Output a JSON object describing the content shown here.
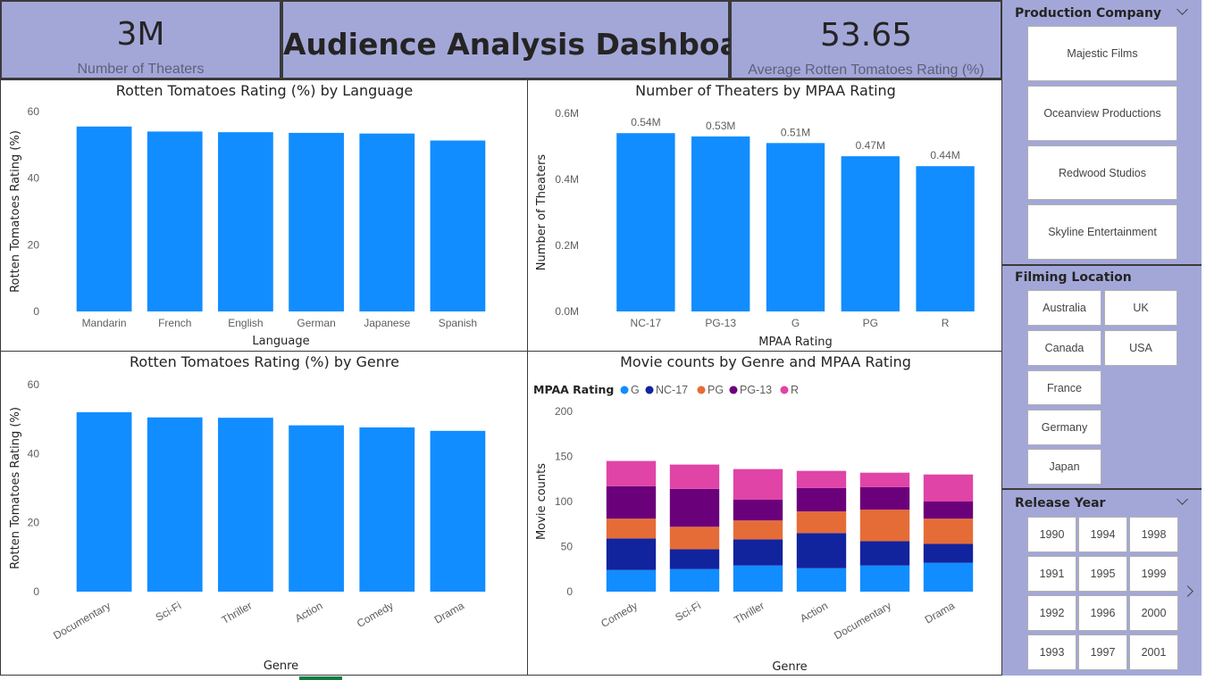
{
  "kpis": {
    "theaters": {
      "value": "3M",
      "label": "Number of Theaters"
    },
    "title": "Audience Analysis Dashboard",
    "rating": {
      "value": "53.65",
      "label": "Average Rotten Tomatoes Rating (%)"
    }
  },
  "slicers": {
    "production": {
      "title": "Production Company",
      "items": [
        "Majestic Films",
        "Oceanview Productions",
        "Redwood Studios",
        "Skyline Entertainment"
      ]
    },
    "location": {
      "title": "Filming Location",
      "items": [
        "Australia",
        "UK",
        "Canada",
        "USA",
        "France",
        "Germany",
        "Japan"
      ]
    },
    "year": {
      "title": "Release Year",
      "items": [
        "1990",
        "1994",
        "1998",
        "1991",
        "1995",
        "1999",
        "1992",
        "1996",
        "2000",
        "1993",
        "1997",
        "2001"
      ]
    }
  },
  "colors": {
    "bar": "#118dff",
    "G": "#118dff",
    "NC-17": "#12239e",
    "PG": "#e66c37",
    "PG-13": "#6b007b",
    "R": "#e044a7",
    "panel_bg": "#a3a7d8"
  },
  "chart_data": [
    {
      "type": "bar",
      "title": "Rotten Tomatoes Rating (%) by Language",
      "xlabel": "Language",
      "ylabel": "Rotten Tomatoes Rating (%)",
      "categories": [
        "Mandarin",
        "French",
        "English",
        "German",
        "Japanese",
        "Spanish"
      ],
      "values": [
        55.5,
        54.0,
        53.8,
        53.6,
        53.4,
        51.3
      ],
      "ylim": [
        0,
        60
      ],
      "yticks": [
        "0",
        "20",
        "40",
        "60"
      ],
      "grid": false
    },
    {
      "type": "bar",
      "title": "Number of Theaters by MPAA Rating",
      "xlabel": "MPAA Rating",
      "ylabel": "Number of Theaters",
      "categories": [
        "NC-17",
        "PG-13",
        "G",
        "PG",
        "R"
      ],
      "values": [
        0.54,
        0.53,
        0.51,
        0.47,
        0.44
      ],
      "data_labels": [
        "0.54M",
        "0.53M",
        "0.51M",
        "0.47M",
        "0.44M"
      ],
      "ylim": [
        0,
        0.6
      ],
      "yticks": [
        "0.0M",
        "0.2M",
        "0.4M",
        "0.6M"
      ],
      "grid": false
    },
    {
      "type": "bar",
      "title": "Rotten Tomatoes Rating (%) by Genre",
      "xlabel": "Genre",
      "ylabel": "Rotten Tomatoes Rating (%)",
      "categories": [
        "Documentary",
        "Sci-Fi",
        "Thriller",
        "Action",
        "Comedy",
        "Drama"
      ],
      "values": [
        52.0,
        50.5,
        50.4,
        48.2,
        47.6,
        46.6
      ],
      "ylim": [
        0,
        60
      ],
      "yticks": [
        "0",
        "20",
        "40",
        "60"
      ],
      "grid": false
    },
    {
      "type": "bar",
      "stacked": true,
      "title": "Movie counts by Genre and MPAA Rating",
      "xlabel": "Genre",
      "ylabel": "Movie counts",
      "legend_title": "MPAA Rating",
      "legend_position": "top-left",
      "categories": [
        "Comedy",
        "Sci-Fi",
        "Thriller",
        "Action",
        "Documentary",
        "Drama"
      ],
      "series": [
        {
          "name": "G",
          "values": [
            24,
            25,
            29,
            26,
            29,
            32
          ]
        },
        {
          "name": "NC-17",
          "values": [
            35,
            22,
            29,
            39,
            27,
            21
          ]
        },
        {
          "name": "PG",
          "values": [
            22,
            25,
            21,
            24,
            35,
            28
          ]
        },
        {
          "name": "PG-13",
          "values": [
            36,
            42,
            23,
            26,
            25,
            19
          ]
        },
        {
          "name": "R",
          "values": [
            28,
            27,
            34,
            19,
            16,
            30
          ]
        }
      ],
      "ylim": [
        0,
        200
      ],
      "yticks": [
        "0",
        "50",
        "100",
        "150",
        "200"
      ],
      "grid": false
    }
  ]
}
